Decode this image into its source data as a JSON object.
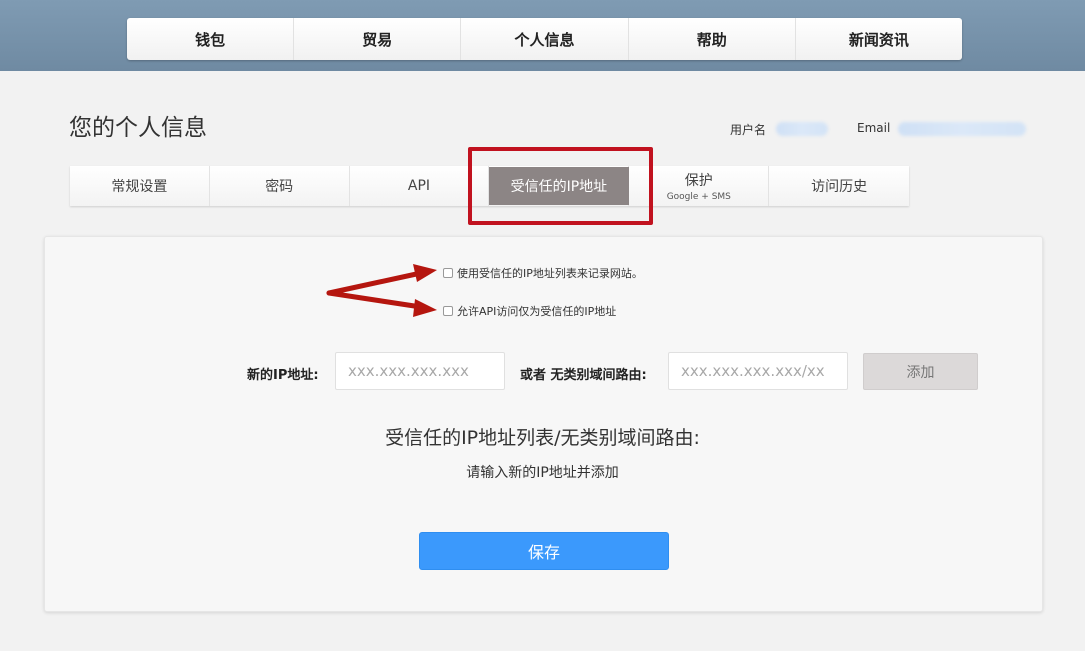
{
  "topnav": {
    "items": [
      {
        "label": "钱包"
      },
      {
        "label": "贸易"
      },
      {
        "label": "个人信息"
      },
      {
        "label": "帮助"
      },
      {
        "label": "新闻资讯"
      }
    ]
  },
  "profile": {
    "title": "您的个人信息",
    "username_label": "用户名",
    "email_label": "Email"
  },
  "subtabs": {
    "general": "常规设置",
    "password": "密码",
    "api": "API",
    "trusted_ip": "受信任的IP地址",
    "protect": "保护",
    "protect_sub": "Google + SMS",
    "history": "访问历史"
  },
  "form": {
    "option_site_login": "使用受信任的IP地址列表来记录网站。",
    "option_api_only": "允许API访问仅为受信任的IP地址",
    "new_ip_label": "新的IP地址:",
    "new_ip_placeholder": "xxx.xxx.xxx.xxx",
    "cidr_label": "或者 无类别域间路由:",
    "cidr_placeholder": "xxx.xxx.xxx.xxx/xx",
    "add_button": "添加",
    "list_title": "受信任的IP地址列表/无类别域间路由:",
    "list_empty_hint": "请输入新的IP地址并添加",
    "save_button": "保存"
  },
  "colors": {
    "header": "#7f9bb3",
    "active_tab": "#8c8585",
    "highlight": "#c1121f",
    "save_button": "#3b99fc"
  }
}
